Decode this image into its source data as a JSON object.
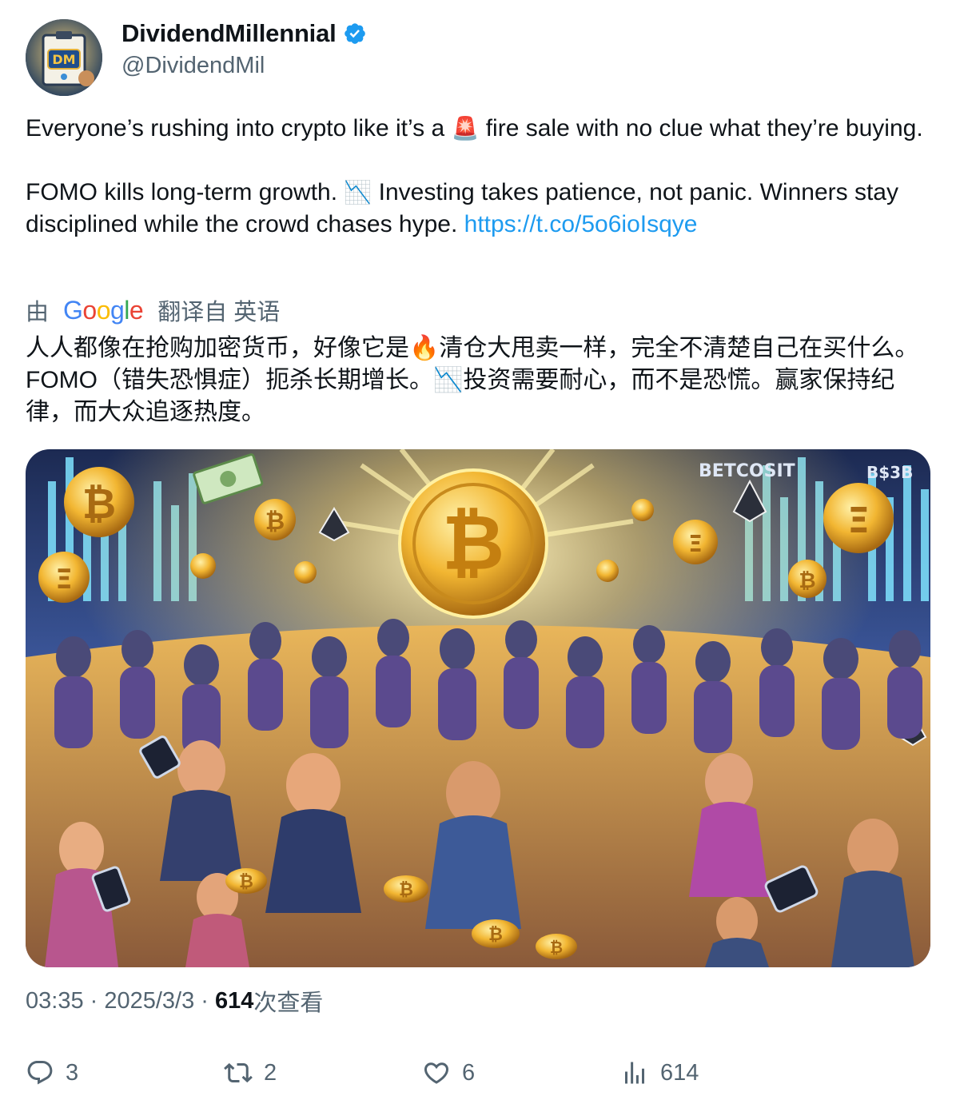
{
  "author": {
    "display_name": "DividendMillennial",
    "handle": "@DividendMil",
    "avatar_initials": "DM"
  },
  "tweet": {
    "paragraph_1_before_emoji": "Everyone’s rushing into crypto like it’s a ",
    "paragraph_1_emoji": "🚨",
    "paragraph_1_after_emoji": " fire sale with no clue what they’re buying.",
    "paragraph_2_before_emoji": "FOMO kills long-term growth. ",
    "paragraph_2_emoji": "📉",
    "paragraph_2_after_emoji": " Investing takes patience, not panic. Winners stay disciplined while the crowd chases hype. ",
    "link": "https://t.co/5o6ioIsqye"
  },
  "translation": {
    "prefix": "由",
    "provider": "Google",
    "suffix": "翻译自 英语",
    "text": "人人都像在抢购加密货币，好像它是🔥清仓大甩卖一样，完全不清楚自己在买什么。 FOMO（错失恐惧症）扼杀长期增长。📉投资需要耐心，而不是恐慌。赢家保持纪律，而大众追逐热度。"
  },
  "media": {
    "sign_left": "BETCOSIT",
    "sign_right": "B$3B"
  },
  "meta": {
    "time": "03:35",
    "sep1": " · ",
    "date": "2025/3/3",
    "sep2": " · ",
    "views_count": "614",
    "views_label": "次查看"
  },
  "actions": {
    "replies": "3",
    "reposts": "2",
    "likes": "6",
    "views": "614"
  },
  "colors": {
    "link": "#1d9bf0",
    "secondary_text": "#536471",
    "verified": "#1d9bf0"
  }
}
